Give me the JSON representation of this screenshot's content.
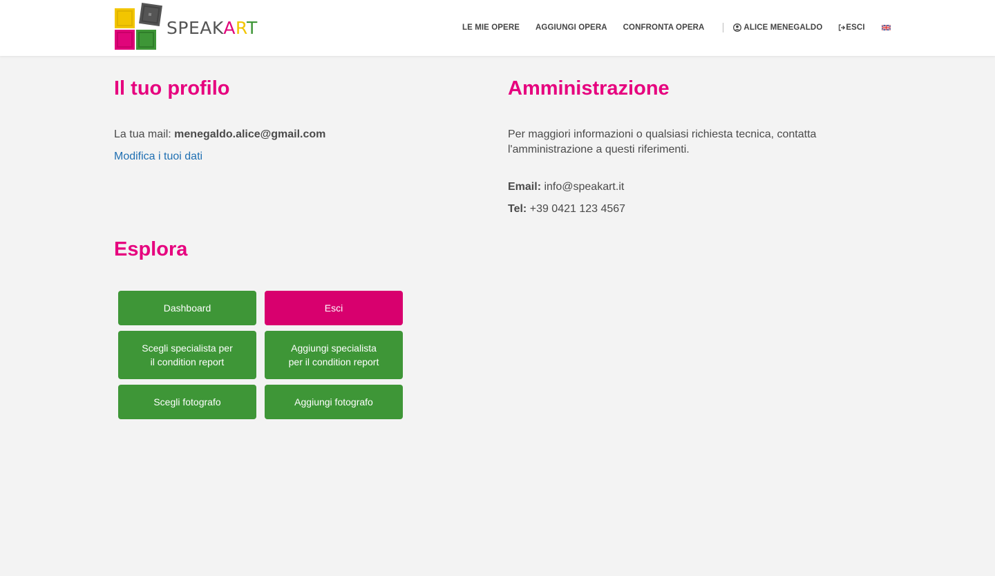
{
  "brand": {
    "name_start": "SPEAK",
    "name_a": "A",
    "name_r": "R",
    "name_t": "T",
    "colors": {
      "pink": "#e6007e",
      "yellow": "#f2c500",
      "green": "#3e9637",
      "dark": "#555555"
    }
  },
  "nav": {
    "items": [
      "LE MIE OPERE",
      "AGGIUNGI OPERA",
      "CONFRONTA OPERA"
    ],
    "user_label": "ALICE MENEGALDO",
    "logout_label": "ESCI",
    "language_icon": "uk-flag-icon"
  },
  "profile": {
    "title": "Il tuo profilo",
    "mail_label": "La tua mail:",
    "mail_value": "menegaldo.alice@gmail.com",
    "edit_link": "Modifica i tuoi dati"
  },
  "admin": {
    "title": "Amministrazione",
    "info_line1": "Per maggiori informazioni o qualsiasi richiesta tecnica, contatta",
    "info_line2": "l'amministrazione a questi riferimenti.",
    "email_label": "Email:",
    "email_value": "info@speakart.it",
    "tel_label": "Tel:",
    "tel_value": "+39 0421 123 4567"
  },
  "explore": {
    "title": "Esplora",
    "buttons": {
      "dashboard": "Dashboard",
      "logout": "Esci",
      "choose_specialist": "Scegli specialista per\nil condition report",
      "add_specialist": "Aggiungi specialista\nper il condition report",
      "choose_photographer": "Scegli fotografo",
      "add_photographer": "Aggiungi fotografo"
    }
  },
  "colors": {
    "accent": "#e6007e",
    "button_green": "#3e9637",
    "button_pink": "#d8006e",
    "link": "#1f6fb2",
    "background": "#f3f3f3"
  }
}
